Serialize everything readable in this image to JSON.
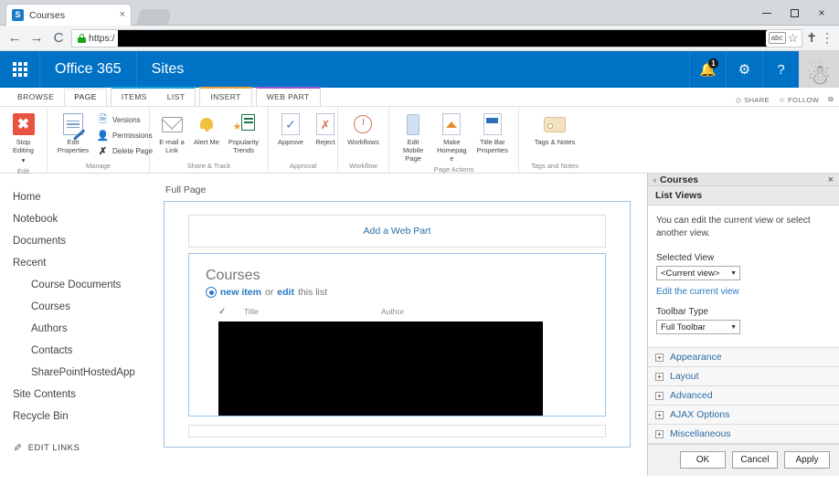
{
  "browser": {
    "tab": {
      "title": "Courses",
      "favicon": "sharepoint-icon",
      "close": "×"
    },
    "nav": {
      "back": "←",
      "forward": "→",
      "reload": "⟳"
    },
    "omnibox": {
      "scheme": "https:/",
      "redacted": true,
      "lock": "lock-icon"
    },
    "omni_right": {
      "abc": "abc",
      "star": "☆"
    },
    "extension_icon": "extension-icon",
    "menu_icon": "⋮",
    "window": {
      "minimize": "—",
      "maximize": "□",
      "close": "×"
    }
  },
  "suitebar": {
    "waffle": "app-launcher-icon",
    "brand": "Office 365",
    "app": "Sites",
    "icons": [
      {
        "name": "notifications-icon",
        "glyph": "🔔",
        "badge": "1"
      },
      {
        "name": "settings-gear-icon",
        "glyph": "⚙"
      },
      {
        "name": "help-icon",
        "glyph": "?"
      }
    ],
    "avatar": "user-avatar"
  },
  "ribbon": {
    "tabs": [
      {
        "label": "BROWSE",
        "active": false,
        "group": null
      },
      {
        "label": "PAGE",
        "active": true,
        "group": null
      },
      {
        "label": "ITEMS",
        "active": false,
        "group": "items"
      },
      {
        "label": "LIST",
        "active": false,
        "group": "items"
      },
      {
        "label": "INSERT",
        "active": false,
        "group": "insert"
      },
      {
        "label": "WEB PART",
        "active": false,
        "group": "webpart"
      }
    ],
    "group_colors": {
      "items": "#18a0d8",
      "insert": "#e8a33d",
      "webpart": "#9b59d0"
    },
    "actions": [
      {
        "label": "SHARE",
        "icon": "share-icon"
      },
      {
        "label": "FOLLOW",
        "icon": "star-icon"
      },
      {
        "label": "",
        "icon": "focus-icon"
      }
    ],
    "groups": [
      {
        "label": "Edit",
        "buttons": [
          {
            "label": "Stop Editing",
            "icon": "stop-editing-icon",
            "dropdown": true
          }
        ],
        "small": []
      },
      {
        "label": "Manage",
        "buttons": [
          {
            "label": "Edit Properties",
            "icon": "edit-properties-icon",
            "dropdown": true
          }
        ],
        "small": [
          {
            "label": "Versions",
            "icon": "versions-icon"
          },
          {
            "label": "Permissions",
            "icon": "permissions-icon"
          },
          {
            "label": "Delete Page",
            "icon": "delete-page-icon"
          }
        ]
      },
      {
        "label": "Share & Track",
        "buttons": [
          {
            "label": "E-mail a Link",
            "icon": "email-link-icon"
          },
          {
            "label": "Alert Me",
            "icon": "alert-me-icon",
            "dropdown": true
          },
          {
            "label": "Popularity Trends",
            "icon": "popularity-trends-icon"
          }
        ],
        "small": []
      },
      {
        "label": "Approval",
        "buttons": [
          {
            "label": "Approve",
            "icon": "approve-icon"
          },
          {
            "label": "Reject",
            "icon": "reject-icon"
          }
        ],
        "small": []
      },
      {
        "label": "Workflow",
        "buttons": [
          {
            "label": "Workflows",
            "icon": "workflows-icon"
          }
        ],
        "small": []
      },
      {
        "label": "Page Actions",
        "buttons": [
          {
            "label": "Edit Mobile Page",
            "icon": "edit-mobile-page-icon",
            "dropdown": true
          },
          {
            "label": "Make Homepage",
            "icon": "make-homepage-icon"
          },
          {
            "label": "Title Bar Properties",
            "icon": "title-bar-properties-icon"
          }
        ],
        "small": []
      },
      {
        "label": "Tags and Notes",
        "buttons": [
          {
            "label": "Tags & Notes",
            "icon": "tags-notes-icon"
          }
        ],
        "small": []
      }
    ]
  },
  "leftnav": {
    "items": [
      {
        "label": "Home",
        "child": false
      },
      {
        "label": "Notebook",
        "child": false
      },
      {
        "label": "Documents",
        "child": false
      },
      {
        "label": "Recent",
        "child": false
      },
      {
        "label": "Course Documents",
        "child": true
      },
      {
        "label": "Courses",
        "child": true
      },
      {
        "label": "Authors",
        "child": true
      },
      {
        "label": "Contacts",
        "child": true
      },
      {
        "label": "SharePointHostedApp",
        "child": true
      },
      {
        "label": "Site Contents",
        "child": false
      },
      {
        "label": "Recycle Bin",
        "child": false
      }
    ],
    "edit_links": "EDIT LINKS",
    "edit_links_icon": "pencil-icon"
  },
  "canvas": {
    "zone_label": "Full Page",
    "add_webpart": "Add a Web Part",
    "webpart": {
      "title": "Courses",
      "cmd_new": "new item",
      "cmd_or": " or ",
      "cmd_edit": "edit",
      "cmd_tail": " this list",
      "columns": {
        "check": "✓",
        "title": "Title",
        "author": "Author"
      }
    }
  },
  "toolpane": {
    "back": "‹",
    "title": "Courses",
    "close": "×",
    "section": "List Views",
    "description": "You can edit the current view or select another view.",
    "selected_view_label": "Selected View",
    "selected_view_value": "<Current view>",
    "edit_view_link": "Edit the current view",
    "toolbar_type_label": "Toolbar Type",
    "toolbar_type_value": "Full Toolbar",
    "accordion": [
      {
        "label": "Appearance",
        "expander": "+"
      },
      {
        "label": "Layout",
        "expander": "+"
      },
      {
        "label": "Advanced",
        "expander": "+"
      },
      {
        "label": "AJAX Options",
        "expander": "+"
      },
      {
        "label": "Miscellaneous",
        "expander": "+"
      }
    ],
    "buttons": {
      "ok": "OK",
      "cancel": "Cancel",
      "apply": "Apply"
    }
  },
  "colors": {
    "suitebar": "#0072c6",
    "accent_link": "#2a78c4",
    "zone_border": "#9cc3e5",
    "stop_editing": "#e8523f"
  }
}
